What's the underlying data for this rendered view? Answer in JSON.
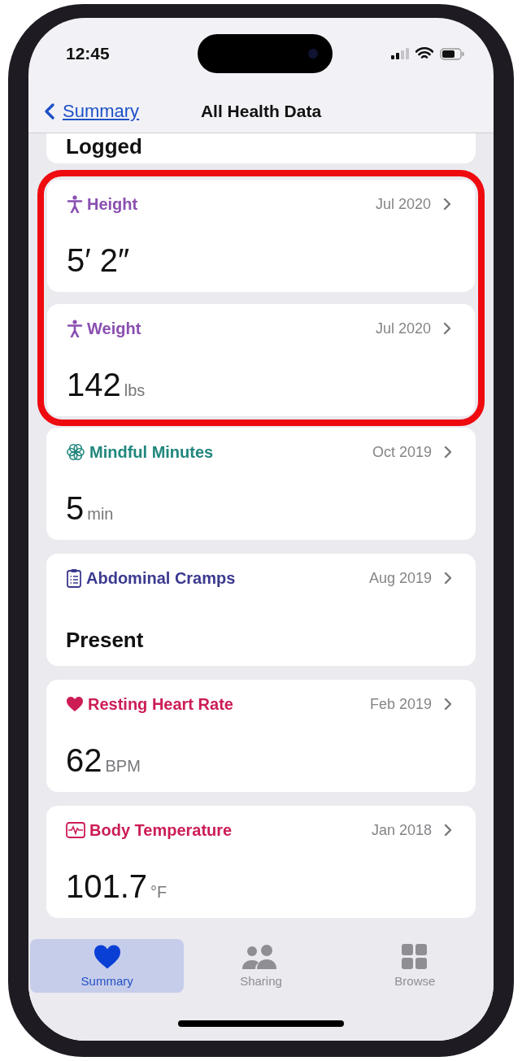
{
  "status_bar": {
    "time": "12:45"
  },
  "nav": {
    "back": "Summary",
    "title": "All Health Data"
  },
  "partial_record": {
    "value": "Logged"
  },
  "records": [
    {
      "color": "#8a4fb0",
      "name": "Height",
      "date": "Jul 2020",
      "kind": "number",
      "value": "5′ 2″",
      "highlighted": true
    },
    {
      "color": "#8a4fb0",
      "name": "Weight",
      "date": "Jul 2020",
      "kind": "number",
      "value": "142",
      "unit": "lbs",
      "highlighted": true
    },
    {
      "color": "#20877d",
      "name": "Mindful Minutes",
      "date": "Oct 2019",
      "kind": "number",
      "value": "5",
      "unit": "min",
      "highlighted": false
    },
    {
      "color": "#3b3a8f",
      "name": "Abdominal Cramps",
      "date": "Aug 2019",
      "kind": "text",
      "value": "Present",
      "highlighted": false
    },
    {
      "color": "#cc1d55",
      "name": "Resting Heart Rate",
      "date": "Feb 2019",
      "kind": "number",
      "value": "62",
      "unit": "BPM",
      "highlighted": false
    },
    {
      "color": "#cc1d55",
      "name": "Body Temperature",
      "date": "Jan 2018",
      "kind": "number",
      "value": "101.7",
      "unit": "°F",
      "highlighted": false
    }
  ],
  "tabs": [
    {
      "label": "Summary",
      "selected": true
    },
    {
      "label": "Sharing",
      "selected": false
    },
    {
      "label": "Browse",
      "selected": false
    }
  ]
}
